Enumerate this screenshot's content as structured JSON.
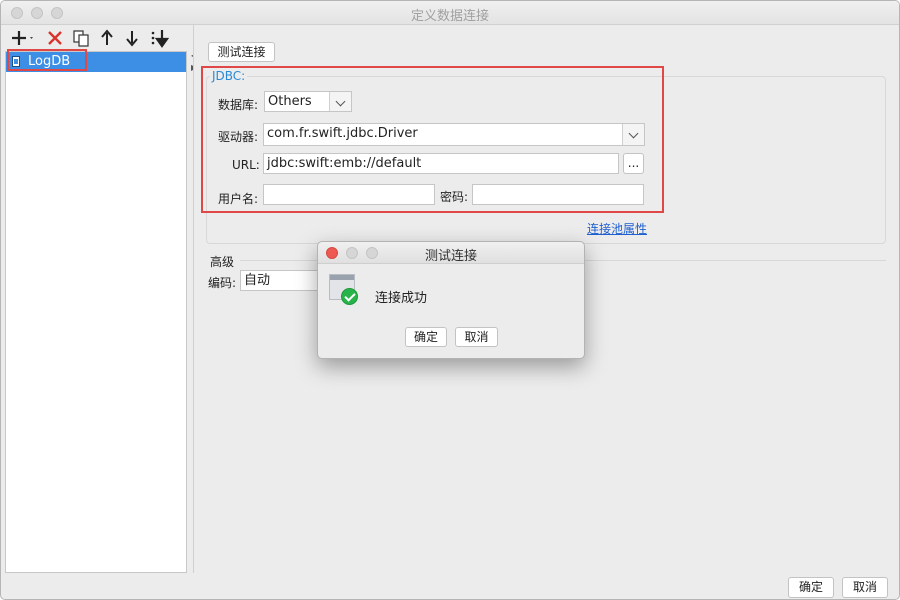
{
  "window": {
    "title": "定义数据连接"
  },
  "toolbar": {
    "add_icon": "plus-icon",
    "delete_icon": "delete-x-icon",
    "copy_icon": "copy-icon",
    "move_up_icon": "arrow-up-icon",
    "move_down_icon": "arrow-down-icon",
    "sort_icon": "sort-icon"
  },
  "tree": {
    "items": [
      {
        "label": "LogDB"
      }
    ]
  },
  "main": {
    "test_button": "测试连接",
    "jdbc_legend": "JDBC:",
    "database_label": "数据库:",
    "database_value": "Others",
    "driver_label": "驱动器:",
    "driver_value": "com.fr.swift.jdbc.Driver",
    "url_label": "URL:",
    "url_value": "jdbc:swift:emb://default",
    "browse_label": "...",
    "username_label": "用户名:",
    "username_value": "",
    "password_label": "密码:",
    "password_value": "",
    "pool_link": "连接池属性",
    "advanced_label": "高级",
    "encoding_label": "编码:",
    "encoding_value": "自动"
  },
  "dialog": {
    "title": "测试连接",
    "message": "连接成功",
    "ok": "确定",
    "cancel": "取消"
  },
  "footer": {
    "ok": "确定",
    "cancel": "取消"
  },
  "colors": {
    "selection": "#3d8fe6",
    "highlight_box": "#e04848",
    "link": "#1f5fcf",
    "legend": "#2a8ad6",
    "success": "#28b44a"
  }
}
